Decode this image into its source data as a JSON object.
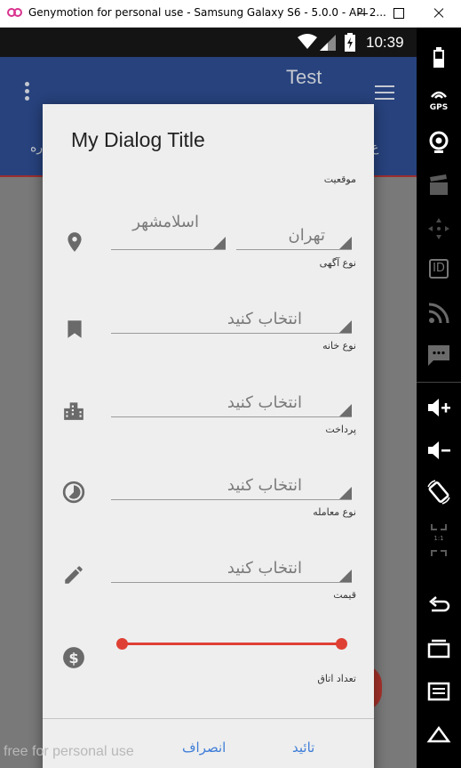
{
  "window": {
    "title": "Genymotion for personal use - Samsung Galaxy S6 - 5.0.0 - API 2..."
  },
  "status_bar": {
    "time": "10:39"
  },
  "app_bar": {
    "title": "Test",
    "tab_text_left": "ره",
    "tab_text_right": "ع"
  },
  "dialog": {
    "title": "My Dialog Title",
    "fields": {
      "location_label": "موقعیت",
      "location_city": "اسلامشهر",
      "location_province": "تهران",
      "ad_type_label": "نوع آگهی",
      "ad_type_value": "انتخاب کنید",
      "house_type_label": "نوع خانه",
      "house_type_value": "انتخاب کنید",
      "payment_label": "پرداخت",
      "payment_value": "انتخاب کنید",
      "deal_type_label": "نوع معامله",
      "deal_type_value": "انتخاب کنید",
      "price_label": "قیمت",
      "rooms_label": "تعداد اتاق"
    },
    "price_range": {
      "min_fraction": 0.0,
      "max_fraction": 1.0
    },
    "buttons": {
      "cancel": "انصراف",
      "confirm": "تائید"
    }
  },
  "watermark": "free for personal use",
  "toolbar": {
    "gps_label": "GPS",
    "id_label": "ID",
    "pixel_label": "1:1",
    "icons": [
      "battery-icon",
      "gps-icon",
      "camera-icon",
      "clapperboard-icon",
      "dpad-icon",
      "id-icon",
      "rss-icon",
      "sms-icon",
      "volume-up-icon",
      "volume-down-icon",
      "rotate-icon",
      "pixel-perfect-icon",
      "back-icon",
      "recent-apps-icon",
      "menu-icon",
      "home-icon"
    ]
  },
  "colors": {
    "app_bar": "#27427d",
    "accent_red": "#df4034",
    "button_blue": "#3f7ed8",
    "dialog_bg": "#eeeeee"
  }
}
